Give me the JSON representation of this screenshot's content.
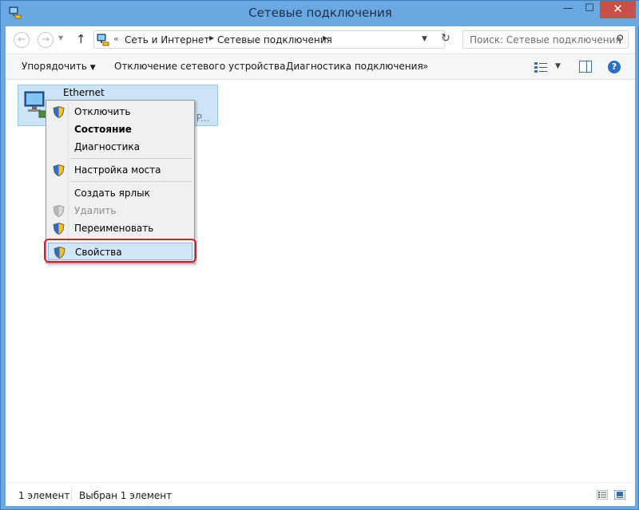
{
  "window": {
    "title": "Сетевые подключения",
    "controls": {
      "minimize": "—",
      "maximize": "☐",
      "close": "✕"
    }
  },
  "nav": {
    "back_icon": "arrow-left-icon",
    "forward_icon": "arrow-right-icon",
    "up_icon": "arrow-up-icon",
    "address": {
      "overflow": "«",
      "breadcrumbs": [
        "Сеть и Интернет",
        "Сетевые подключения"
      ]
    },
    "search": {
      "placeholder": "Поиск: Сетевые подключения"
    }
  },
  "toolbar": {
    "organize": "Упорядочить",
    "disable": "Отключение сетевого устройства",
    "diagnose": "Диагностика подключения",
    "more": "»"
  },
  "connection": {
    "name": "Ethernet",
    "device_fragment": "k P..."
  },
  "context_menu": {
    "items": [
      {
        "label": "Отключить",
        "shield": true,
        "bold": false,
        "disabled": false
      },
      {
        "label": "Состояние",
        "shield": false,
        "bold": true,
        "disabled": false
      },
      {
        "label": "Диагностика",
        "shield": false,
        "bold": false,
        "disabled": false
      },
      {
        "label": "Настройка моста",
        "shield": true,
        "bold": false,
        "disabled": false
      },
      {
        "label": "Создать ярлык",
        "shield": false,
        "bold": false,
        "disabled": false
      },
      {
        "label": "Удалить",
        "shield": true,
        "bold": false,
        "disabled": true
      },
      {
        "label": "Переименовать",
        "shield": true,
        "bold": false,
        "disabled": false
      },
      {
        "label": "Свойства",
        "shield": true,
        "bold": false,
        "disabled": false,
        "highlighted": true
      }
    ]
  },
  "status": {
    "count": "1 элемент",
    "selected": "Выбран 1 элемент"
  },
  "colors": {
    "frame": "#6aa8e2",
    "close_button": "#c7504a",
    "selection": "#cce4f7",
    "annotation_ring": "#d61f2c"
  }
}
